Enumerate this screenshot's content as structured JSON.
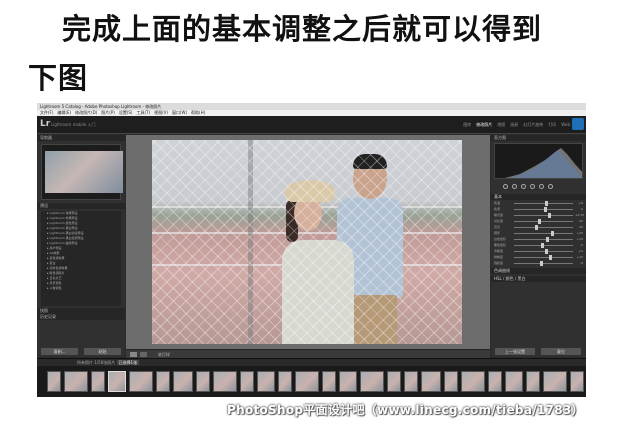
{
  "heading": {
    "line1": "完成上面的基本调整之后就可以得到",
    "line2": "下图"
  },
  "app": {
    "window_title": "Lightroom 5 Catalog - Adobe Photoshop Lightroom - 修改照片",
    "menu": [
      "文件(F)",
      "编辑(E)",
      "修改照片(D)",
      "照片(P)",
      "设置(S)",
      "工具(T)",
      "视图(V)",
      "窗口(W)",
      "帮助(H)"
    ],
    "logo": "Lr",
    "identity": "Lightroom mobile 入门",
    "modules": [
      "图库",
      "修改照片",
      "地图",
      "画册",
      "幻灯片放映",
      "打印",
      "Web"
    ],
    "active_module": "修改照片"
  },
  "left_panel": {
    "navigator_header": "导航器",
    "presets_header": "预设",
    "presets": [
      "Lightroom 常规预设",
      "Lightroom 效果预设",
      "Lightroom 颜色预设",
      "Lightroom 黑白预设",
      "Lightroom 黑白滤镜预设",
      "Lightroom 黑白色调预设",
      "Lightroom 曲线预设",
      "用户预设",
      "AS效果",
      "亮色调效果",
      "复古",
      "清新色调效果",
      "暖色调照片",
      "日系文艺",
      "风景调色",
      "人像调色"
    ],
    "snapshots_header": "快照",
    "history_header": "历史记录",
    "copy_button": "复制...",
    "paste_button": "粘贴"
  },
  "toolbar": {
    "label": "软打样"
  },
  "right_panel": {
    "histogram_header": "直方图",
    "camera_info": "原始照片",
    "basic_header": "基本",
    "sliders": [
      {
        "label": "色温",
        "value": "+8"
      },
      {
        "label": "色调",
        "value": "0"
      },
      {
        "label": "曝光度",
        "value": "+0.35"
      },
      {
        "label": "对比度",
        "value": "-20"
      },
      {
        "label": "高光",
        "value": "-30"
      },
      {
        "label": "阴影",
        "value": "+25"
      },
      {
        "label": "白色色阶",
        "value": "+10"
      },
      {
        "label": "黑色色阶",
        "value": "-5"
      },
      {
        "label": "清晰度",
        "value": "+5"
      },
      {
        "label": "鲜艳度",
        "value": "+15"
      },
      {
        "label": "饱和度",
        "value": "-8"
      }
    ],
    "tone_curve_header": "色调曲线",
    "hsl_header": "HSL / 颜色 / 黑白",
    "previous_button": "上一张设置",
    "reset_button": "复位"
  },
  "filmstrip": {
    "label": "所有照片",
    "count": "1/56张照片",
    "active": "已选择1张",
    "filter_label": "过滤器：",
    "thumb_count": 26
  },
  "watermark": "PhotoShop平面设计吧（www.linecg.com/tieba/1783）",
  "colors": {
    "lr_background": "#2b2b2b",
    "panel": "#303030",
    "accent_blue": "#1d6fb8"
  }
}
